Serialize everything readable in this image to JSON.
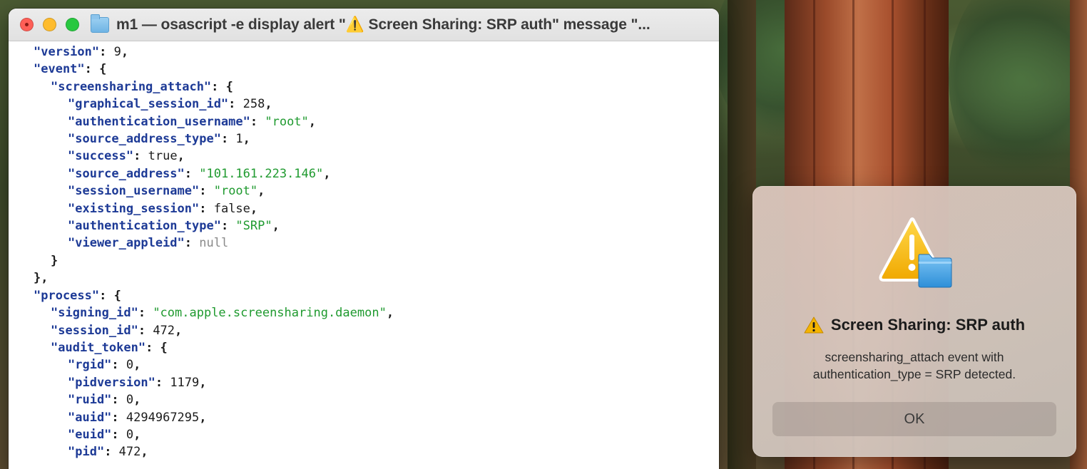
{
  "terminal": {
    "title": "m1 — osascript -e display alert \"⚠️ Screen Sharing: SRP auth\" message \"...",
    "folder_icon": "folder-icon"
  },
  "code_lines": [
    {
      "indent": 0,
      "key": "\"version\"",
      "sep": ": ",
      "val": "9",
      "vtype": "n",
      "tail": ","
    },
    {
      "indent": 0,
      "key": "\"event\"",
      "sep": ": ",
      "val": "{",
      "vtype": "p",
      "tail": ""
    },
    {
      "indent": 1,
      "key": "\"screensharing_attach\"",
      "sep": ": ",
      "val": "{",
      "vtype": "p",
      "tail": ""
    },
    {
      "indent": 2,
      "key": "\"graphical_session_id\"",
      "sep": ": ",
      "val": "258",
      "vtype": "n",
      "tail": ","
    },
    {
      "indent": 2,
      "key": "\"authentication_username\"",
      "sep": ": ",
      "val": "\"root\"",
      "vtype": "s",
      "tail": ","
    },
    {
      "indent": 2,
      "key": "\"source_address_type\"",
      "sep": ": ",
      "val": "1",
      "vtype": "n",
      "tail": ","
    },
    {
      "indent": 2,
      "key": "\"success\"",
      "sep": ": ",
      "val": "true",
      "vtype": "n",
      "tail": ","
    },
    {
      "indent": 2,
      "key": "\"source_address\"",
      "sep": ": ",
      "val": "\"101.161.223.146\"",
      "vtype": "s",
      "tail": ","
    },
    {
      "indent": 2,
      "key": "\"session_username\"",
      "sep": ": ",
      "val": "\"root\"",
      "vtype": "s",
      "tail": ","
    },
    {
      "indent": 2,
      "key": "\"existing_session\"",
      "sep": ": ",
      "val": "false",
      "vtype": "n",
      "tail": ","
    },
    {
      "indent": 2,
      "key": "\"authentication_type\"",
      "sep": ": ",
      "val": "\"SRP\"",
      "vtype": "s",
      "tail": ","
    },
    {
      "indent": 2,
      "key": "\"viewer_appleid\"",
      "sep": ": ",
      "val": "null",
      "vtype": "nl",
      "tail": ""
    },
    {
      "indent": 1,
      "key": "",
      "sep": "",
      "val": "}",
      "vtype": "p",
      "tail": ""
    },
    {
      "indent": 0,
      "key": "",
      "sep": "",
      "val": "},",
      "vtype": "p",
      "tail": ""
    },
    {
      "indent": 0,
      "key": "\"process\"",
      "sep": ": ",
      "val": "{",
      "vtype": "p",
      "tail": ""
    },
    {
      "indent": 1,
      "key": "\"signing_id\"",
      "sep": ": ",
      "val": "\"com.apple.screensharing.daemon\"",
      "vtype": "s",
      "tail": ","
    },
    {
      "indent": 1,
      "key": "\"session_id\"",
      "sep": ": ",
      "val": "472",
      "vtype": "n",
      "tail": ","
    },
    {
      "indent": 1,
      "key": "\"audit_token\"",
      "sep": ": ",
      "val": "{",
      "vtype": "p",
      "tail": ""
    },
    {
      "indent": 2,
      "key": "\"rgid\"",
      "sep": ": ",
      "val": "0",
      "vtype": "n",
      "tail": ","
    },
    {
      "indent": 2,
      "key": "\"pidversion\"",
      "sep": ": ",
      "val": "1179",
      "vtype": "n",
      "tail": ","
    },
    {
      "indent": 2,
      "key": "\"ruid\"",
      "sep": ": ",
      "val": "0",
      "vtype": "n",
      "tail": ","
    },
    {
      "indent": 2,
      "key": "\"auid\"",
      "sep": ": ",
      "val": "4294967295",
      "vtype": "n",
      "tail": ","
    },
    {
      "indent": 2,
      "key": "\"euid\"",
      "sep": ": ",
      "val": "0",
      "vtype": "n",
      "tail": ","
    },
    {
      "indent": 2,
      "key": "\"pid\"",
      "sep": ": ",
      "val": "472",
      "vtype": "n",
      "tail": ","
    }
  ],
  "alert": {
    "icon": "warning-folder-icon",
    "title": "Screen Sharing: SRP auth",
    "message_line1": "screensharing_attach event with",
    "message_line2": "authentication_type = SRP detected.",
    "ok_label": "OK"
  },
  "colors": {
    "json_key": "#1d3a96",
    "json_string": "#1f9a2f",
    "json_null": "#8a8a8a",
    "close": "#fe5f57",
    "minimize": "#febc2e",
    "maximize": "#28c840"
  }
}
